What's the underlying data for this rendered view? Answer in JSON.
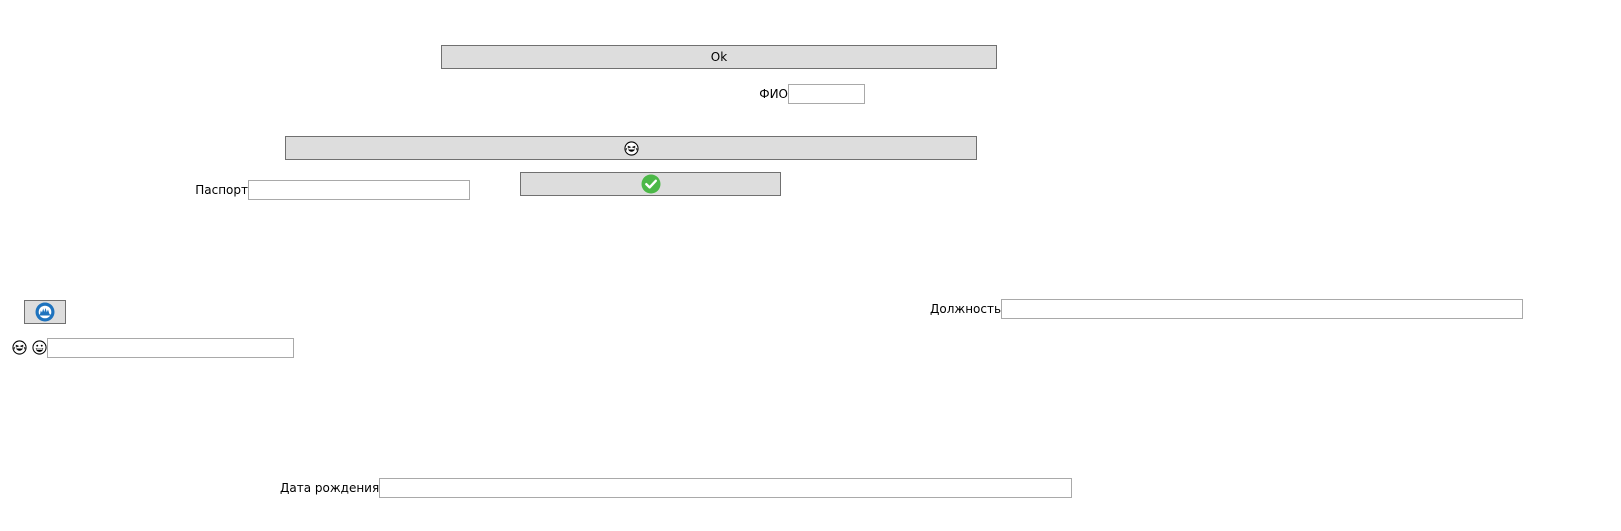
{
  "buttons": {
    "ok_label": "Ok",
    "laugh_icon": "grinning-squinting-face-with-tears-icon",
    "check_icon": "green-checkmark-circle-icon",
    "image_icon": "blue-circular-image-icon"
  },
  "fields": {
    "fio": {
      "label": "ФИО",
      "value": ""
    },
    "passport": {
      "label": "Паспорт",
      "value": ""
    },
    "position": {
      "label": "Должность",
      "value": ""
    },
    "emoji_field": {
      "icons": [
        "grinning-squinting-face-with-tears-icon",
        "grinning-face-icon"
      ],
      "value": ""
    },
    "birth_date": {
      "label": "Дата рождения",
      "value": ""
    }
  },
  "colors": {
    "button_bg": "#dddddd",
    "button_border": "#707070",
    "field_border": "#a9a9a9",
    "check_green": "#4cb848",
    "image_blue": "#1e73be"
  }
}
